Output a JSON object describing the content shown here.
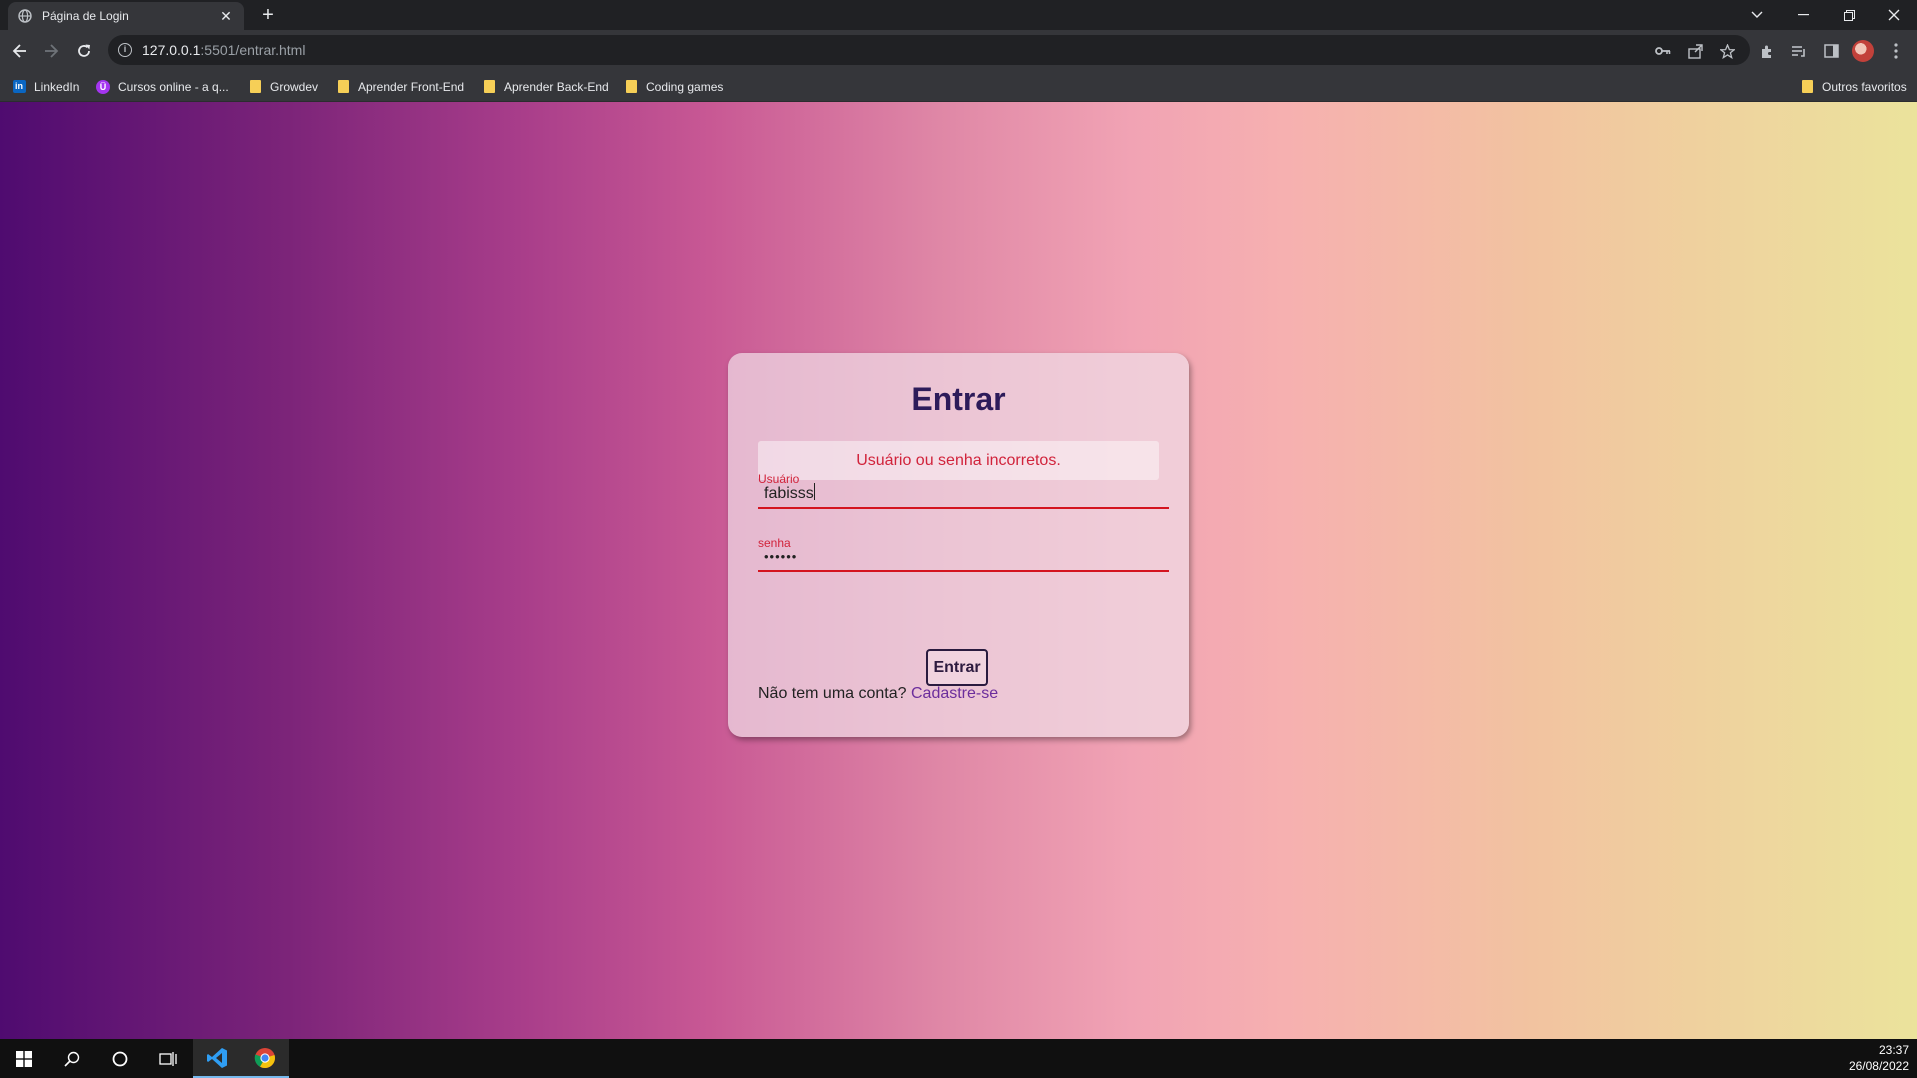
{
  "browser": {
    "tab_title": "Página de Login",
    "url_host": "127.0.0.1",
    "url_path": ":5501/entrar.html",
    "bookmarks": [
      {
        "label": "LinkedIn",
        "icon": "linkedin-icon"
      },
      {
        "label": "Cursos online - a q...",
        "icon": "udemy-icon"
      },
      {
        "label": "Growdev",
        "icon": "folder-icon"
      },
      {
        "label": "Aprender Front-End",
        "icon": "folder-icon"
      },
      {
        "label": "Aprender Back-End",
        "icon": "folder-icon"
      },
      {
        "label": "Coding games",
        "icon": "folder-icon"
      }
    ],
    "other_bookmarks": "Outros favoritos"
  },
  "login": {
    "title": "Entrar",
    "error_message": "Usuário ou senha incorretos.",
    "username_label": "Usuário",
    "username_value": "fabisss",
    "password_label": "senha",
    "password_value": "••••••",
    "submit_label": "Entrar",
    "signup_prompt": "Não tem uma conta?",
    "signup_link": "Cadastre-se"
  },
  "colors": {
    "error": "#d1233b",
    "title": "#2d1b5a",
    "link": "#6b2d9c"
  },
  "taskbar": {
    "time": "23:37",
    "date": "26/08/2022"
  }
}
